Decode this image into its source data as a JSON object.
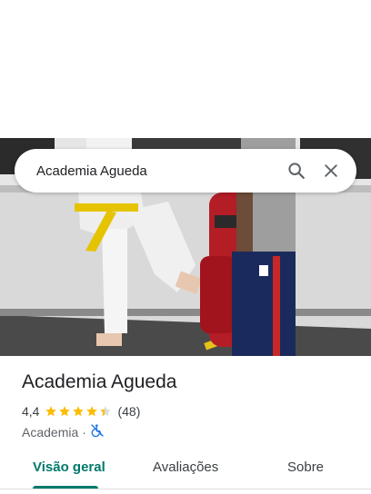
{
  "search": {
    "query": "Academia Agueda",
    "search_icon": "search-icon",
    "close_icon": "close-icon"
  },
  "place": {
    "name": "Academia Agueda",
    "rating": "4,4",
    "rating_value": 4.4,
    "review_count": "(48)",
    "category": "Academia",
    "separator": "·",
    "accessibility_icon": "wheelchair-not-accessible-icon"
  },
  "tabs": [
    {
      "label": "Visão geral",
      "active": true
    },
    {
      "label": "Avaliações",
      "active": false
    },
    {
      "label": "Sobre",
      "active": false
    }
  ],
  "colors": {
    "accent": "#00796b",
    "star": "#fbbc04",
    "star_empty": "#dadce0",
    "icon_blue": "#1a73e8"
  }
}
